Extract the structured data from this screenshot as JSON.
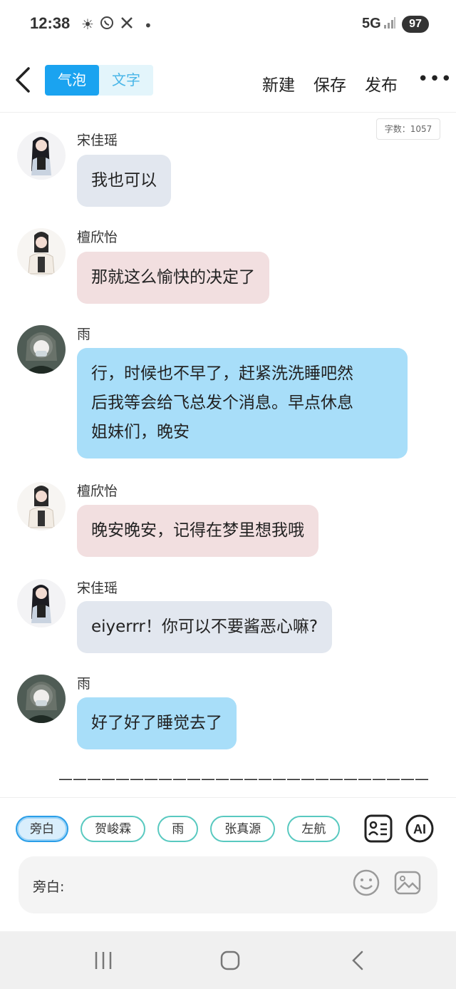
{
  "status": {
    "time": "12:38",
    "network": "5G",
    "battery": "97",
    "icons": [
      "sun-icon",
      "whatsapp-icon",
      "x-icon",
      "dot-icon",
      "signal-icon"
    ]
  },
  "header": {
    "tab_bubble": "气泡",
    "tab_text": "文字",
    "new_label": "新建",
    "save_label": "保存",
    "publish_label": "发布",
    "more_label": "•••"
  },
  "word_count": "字数：1057",
  "messages": [
    {
      "name": "宋佳瑶",
      "text": "我也可以"
    },
    {
      "name": "檀欣怡",
      "text": "那就这么愉快的决定了"
    },
    {
      "name": "雨",
      "lines": [
        "行，时候也不早了，赶紧洗洗睡吧然",
        "后我等会给飞总发个消息。早点休息",
        "姐妹们，晚安"
      ]
    },
    {
      "name": "檀欣怡",
      "text": "晚安晚安，记得在梦里想我哦"
    },
    {
      "name": "宋佳瑶",
      "text": "eiyerrr！你可以不要酱恶心嘛?"
    },
    {
      "name": "雨",
      "text": "好了好了睡觉去了"
    }
  ],
  "divider": "——————————————————————————",
  "roles": [
    "旁白",
    "贺峻霖",
    "雨",
    "张真源",
    "左航"
  ],
  "input": {
    "label": "旁白:"
  },
  "colors": {
    "accent": "#1aa3f0",
    "bubble_gray": "#e2e7ef",
    "bubble_pink": "#f2dfe0",
    "bubble_blue": "#a8def9"
  }
}
